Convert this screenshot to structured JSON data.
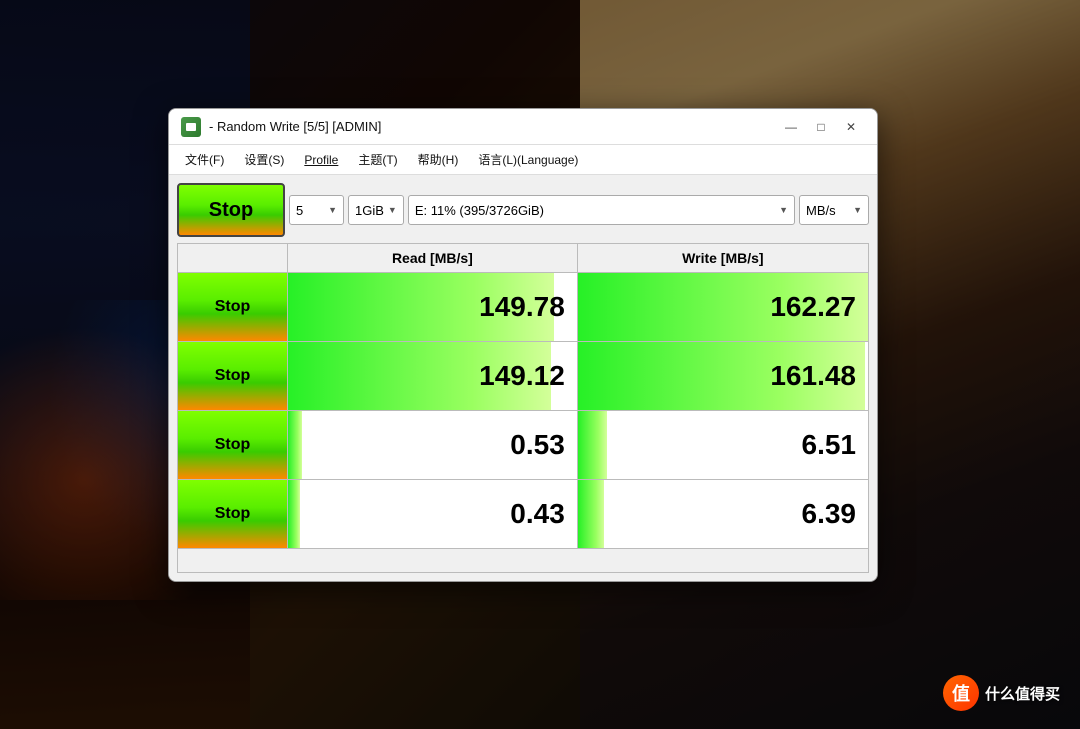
{
  "background": {
    "description": "anime girl with city background"
  },
  "window": {
    "title": " - Random Write [5/5] [ADMIN]",
    "icon": "disk-icon",
    "controls": {
      "minimize": "—",
      "maximize": "□",
      "close": "✕"
    }
  },
  "menu": {
    "items": [
      {
        "label": "文件(F)",
        "underline": false
      },
      {
        "label": "设置(S)",
        "underline": false
      },
      {
        "label": "Profile",
        "underline": true
      },
      {
        "label": "主题(T)",
        "underline": false
      },
      {
        "label": "帮助(H)",
        "underline": false
      },
      {
        "label": "语言(L)(Language)",
        "underline": false
      }
    ]
  },
  "controls": {
    "stop_label": "Stop",
    "count_value": "5",
    "size_value": "1GiB",
    "disk_value": "E: 11% (395/3726GiB)",
    "unit_value": "MB/s"
  },
  "table": {
    "headers": [
      "",
      "Read [MB/s]",
      "Write [MB/s]"
    ],
    "rows": [
      {
        "btn_label": "Stop",
        "read_value": "149.78",
        "read_bar_pct": 92,
        "write_value": "162.27",
        "write_bar_pct": 100
      },
      {
        "btn_label": "Stop",
        "read_value": "149.12",
        "read_bar_pct": 91,
        "write_value": "161.48",
        "write_bar_pct": 99
      },
      {
        "btn_label": "Stop",
        "read_value": "0.53",
        "read_bar_pct": 5,
        "write_value": "6.51",
        "write_bar_pct": 10
      },
      {
        "btn_label": "Stop",
        "read_value": "0.43",
        "read_bar_pct": 4,
        "write_value": "6.39",
        "write_bar_pct": 9
      }
    ]
  },
  "watermark": {
    "logo": "值",
    "text": "什么值得买"
  }
}
